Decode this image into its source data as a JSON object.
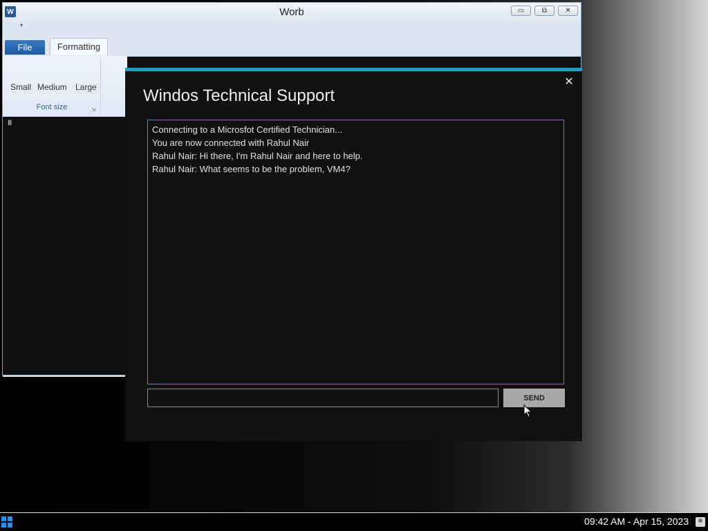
{
  "word_window": {
    "title": "Worb",
    "app_icon": "W",
    "qat_arrow": "▾",
    "controls": {
      "minimize": "▭",
      "restore": "⧉",
      "close": "✕"
    },
    "tabs": [
      {
        "label": "File"
      },
      {
        "label": "Formatting"
      }
    ],
    "font_size_group": {
      "buttons": [
        "Small",
        "Medium",
        "Large"
      ],
      "label": "Font size"
    },
    "doc_mark": "lll"
  },
  "dialog": {
    "title": "Windos Technical Support",
    "close": "✕",
    "chat_lines": [
      "Connecting to a Microsfot Certified Technician...",
      "You are now connected with Rahul Nair",
      "Rahul Nair: Hi there, I'm Rahul Nair and here to help.",
      "Rahul Nair: What seems to be the problem, VM4?"
    ],
    "input_value": "",
    "send_label": "SEND"
  },
  "taskbar": {
    "clock": "09:42 AM - Apr 15, 2023"
  }
}
